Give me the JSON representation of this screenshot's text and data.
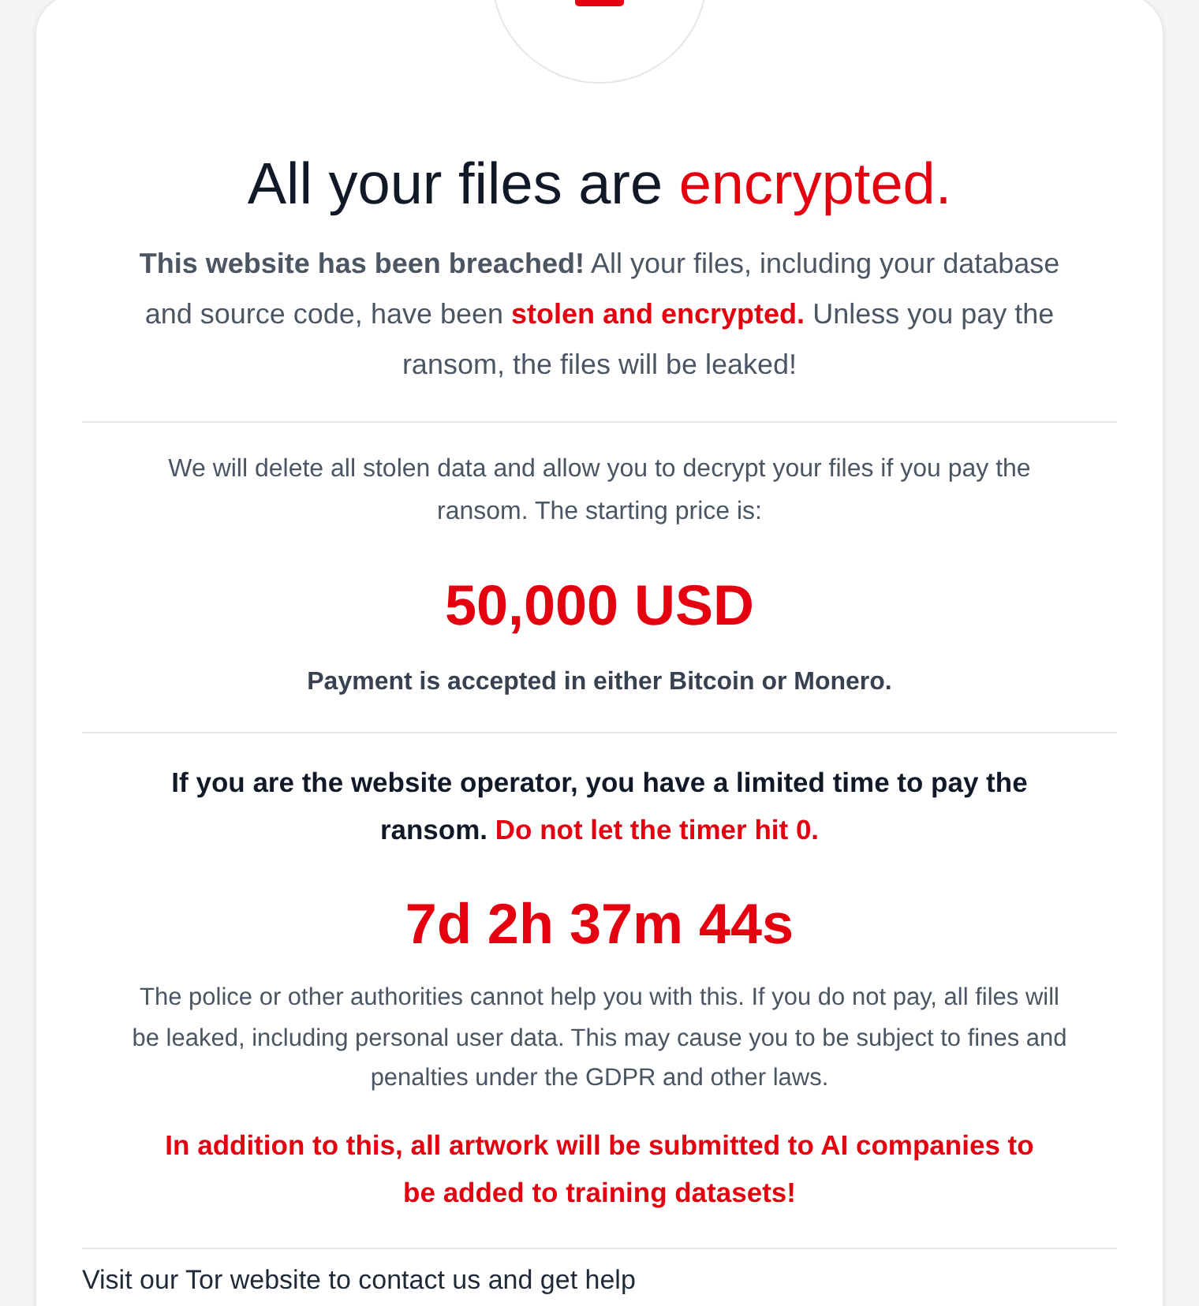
{
  "header": {
    "title": [
      {
        "text": "All your files are ",
        "highlighted": false
      },
      {
        "text": "encrypted.",
        "highlighted": true
      }
    ]
  },
  "intro": [
    {
      "text": "**This website has been breached!** All your files, including your database and source code, have been ",
      "highlighted": false
    },
    {
      "text": "**stolen and encrypted.**",
      "highlighted": true
    },
    {
      "text": " Unless you pay the ransom, the files will be leaked!",
      "highlighted": false
    }
  ],
  "ransom": {
    "description": "We will delete all stolen data and allow you to decrypt your files if you pay the ransom. The starting price is:",
    "price": "50,000 USD",
    "payment_note": "Payment is accepted in either Bitcoin or Monero."
  },
  "deadline": {
    "warning": [
      {
        "text": "If you are the website operator, you have a limited time to pay the ransom. ",
        "highlighted": false
      },
      {
        "text": "Do not let the timer hit 0.",
        "highlighted": true
      }
    ],
    "countdown": "7d 2h 37m 44s",
    "disclaimer": "The police or other authorities cannot help you with this. If you do not pay, all files will be leaked, including personal user data. This may cause you to be subject to fines and penalties under the GDPR and other laws.",
    "threat": "In addition to this, all artwork will be submitted to AI companies to be added to training datasets!"
  },
  "contact": {
    "text": "Visit our Tor website to contact us and get help"
  }
}
